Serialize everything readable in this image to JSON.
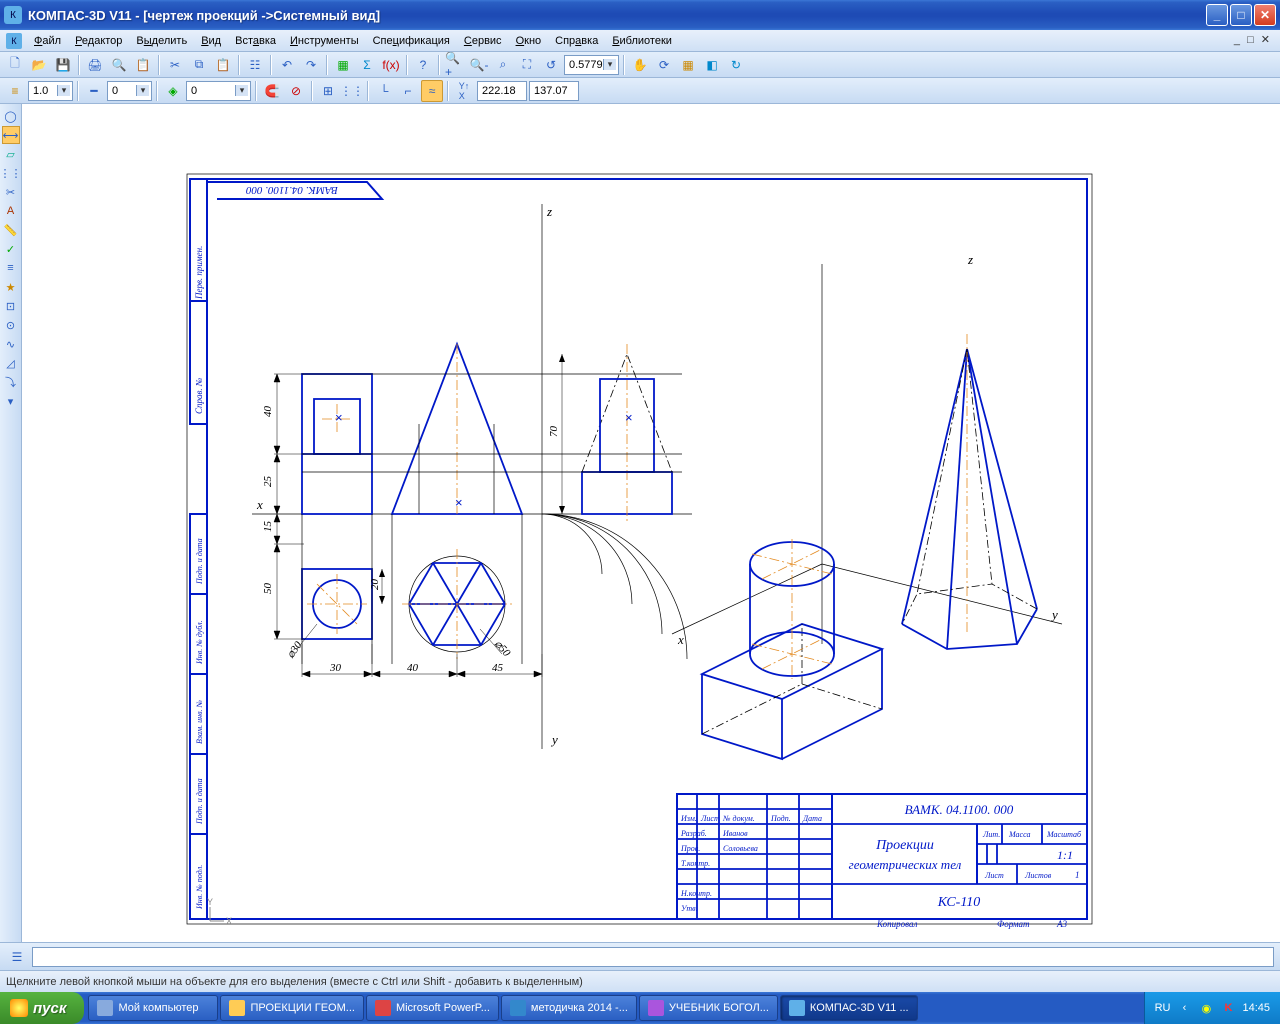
{
  "title": "КОМПАС-3D V11 - [чертеж проекций ->Системный вид]",
  "menu": {
    "items": [
      "Файл",
      "Редактор",
      "Выделить",
      "Вид",
      "Вставка",
      "Инструменты",
      "Спецификация",
      "Сервис",
      "Окно",
      "Справка",
      "Библиотеки"
    ]
  },
  "toolbar1": {
    "icons": [
      "new",
      "open",
      "save",
      "sep",
      "print",
      "preview",
      "sep",
      "cut",
      "copy",
      "paste",
      "sep",
      "props",
      "sep",
      "undo",
      "redo",
      "sep",
      "macro",
      "fx",
      "var",
      "sep",
      "help",
      "sep",
      "zoomin",
      "zoomout",
      "zoomwin",
      "zoomall",
      "scale",
      "sep",
      "pan",
      "rotate",
      "layers",
      "render",
      "refresh"
    ],
    "scale_value": "0.5779"
  },
  "toolbar2": {
    "style_value": "1.0",
    "l2_value": "0",
    "layer_value": "0",
    "coord_x": "222.18",
    "coord_y": "137.07"
  },
  "status_text": "Щелкните левой кнопкой мыши на объекте для его выделения (вместе с Ctrl или Shift - добавить к выделенным)",
  "taskbar": {
    "start": "пуск",
    "tasks": [
      {
        "label": "Мой компьютер",
        "icon": "#8ad"
      },
      {
        "label": "ПРОЕКЦИИ ГЕОМ...",
        "icon": "#fc5"
      },
      {
        "label": "Microsoft PowerP...",
        "icon": "#d44"
      },
      {
        "label": "методичка 2014 -...",
        "icon": "#38c"
      },
      {
        "label": "УЧЕБНИК БОГОЛ...",
        "icon": "#a5d"
      },
      {
        "label": "КОМПАС-3D V11 ...",
        "icon": "#5fb0e8",
        "active": true
      }
    ],
    "lang": "RU",
    "time": "14:45"
  },
  "drawing": {
    "frame_code_top": "ВАМК. 04.1100. 000",
    "axes": {
      "x": "x",
      "y": "y",
      "z": "z"
    },
    "dims": {
      "d40": "40",
      "d25": "25",
      "d15": "15",
      "d50": "50",
      "d30": "30",
      "d40b": "40",
      "d45": "45",
      "d70": "70",
      "d20": "20",
      "dia30": "⌀30",
      "dia50": "⌀50"
    },
    "stamp": {
      "code": "ВАМК. 04.1100. 000",
      "title1": "Проекции",
      "title2": "геометрических тел",
      "group": "КС-110",
      "headers": {
        "izm": "Изм.",
        "list": "Лист",
        "ndoc": "№ докум.",
        "podp": "Подп.",
        "data": "Дата",
        "razrab": "Разраб.",
        "prov": "Пров.",
        "tkontr": "Т.контр.",
        "nkontr": "Н.контр.",
        "utv": "Утв.",
        "lit": "Лит.",
        "massa": "Масса",
        "masht": "Масштаб",
        "list2": "Лист",
        "listov": "Листов",
        "kopiroval": "Копировал",
        "format": "Формат",
        "fmtval": "А3",
        "scale": "1:1",
        "listovval": "1",
        "name1": "Иванов",
        "name2": "Соловьева"
      },
      "sideblock": {
        "l1": "Инв. № подл.",
        "l2": "Подп. и дата",
        "l3": "Взам. инв. №",
        "l4": "Инв. № дубл.",
        "l5": "Подп. и дата",
        "l6": "Справ. №",
        "l7": "Перв. примен."
      }
    }
  }
}
